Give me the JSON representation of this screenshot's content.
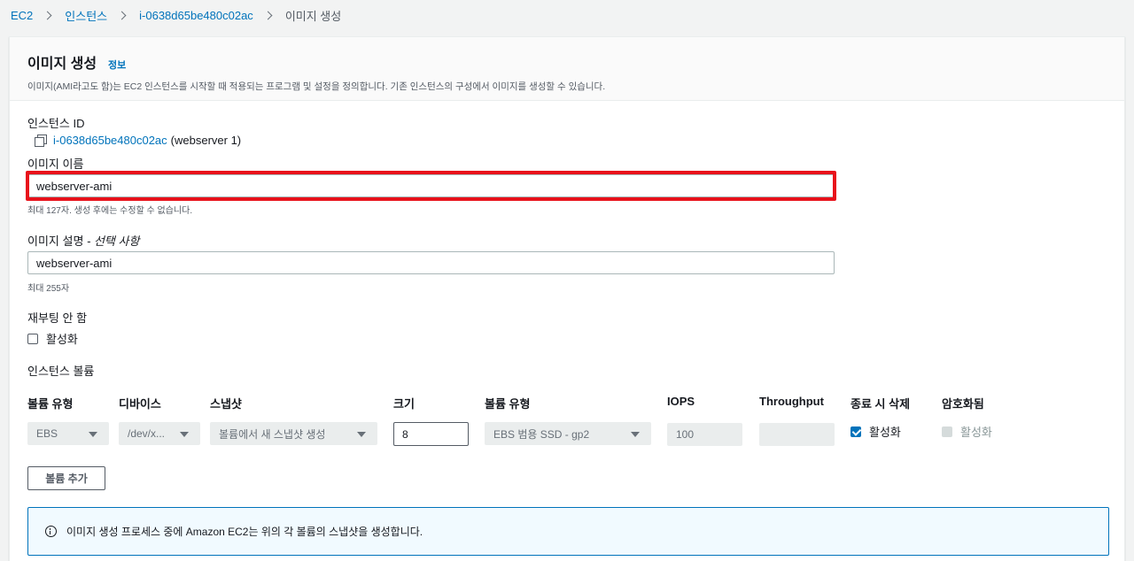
{
  "breadcrumb": {
    "items": [
      "EC2",
      "인스턴스",
      "i-0638d65be480c02ac"
    ],
    "current": "이미지 생성"
  },
  "header": {
    "title": "이미지 생성",
    "info_link": "정보",
    "description": "이미지(AMI라고도 함)는 EC2 인스턴스를 시작할 때 적용되는 프로그램 및 설정을 정의합니다. 기존 인스턴스의 구성에서 이미지를 생성할 수 있습니다."
  },
  "instance": {
    "label": "인스턴스 ID",
    "id": "i-0638d65be480c02ac",
    "name_suffix": "(webserver 1)"
  },
  "image_name": {
    "label": "이미지 이름",
    "value": "webserver-ami",
    "hint": "최대 127자. 생성 후에는 수정할 수 없습니다."
  },
  "image_description": {
    "label": "이미지 설명",
    "label_optional": " - 선택 사항",
    "value": "webserver-ami",
    "hint": "최대 255자"
  },
  "no_reboot": {
    "label": "재부팅 안 함",
    "checkbox_label": "활성화",
    "checked": false
  },
  "volumes": {
    "label": "인스턴스 볼륨",
    "columns": [
      "볼륨 유형",
      "디바이스",
      "스냅샷",
      "크기",
      "볼륨 유형",
      "IOPS",
      "Throughput",
      "종료 시 삭제",
      "암호화됨"
    ],
    "row": {
      "volume_type": "EBS",
      "device": "/dev/x...",
      "snapshot": "볼륨에서 새 스냅샷 생성",
      "size": "8",
      "ebs_type": "EBS 범용 SSD - gp2",
      "iops": "100",
      "throughput": "",
      "delete_on_termination_label": "활성화",
      "encrypted_label": "활성화"
    },
    "add_button": "볼륨 추가"
  },
  "alert": {
    "icon": "info-icon",
    "text": "이미지 생성 프로세스 중에 Amazon EC2는 위의 각 볼륨의 스냅샷을 생성합니다."
  },
  "colors": {
    "link": "#0073bb",
    "highlight": "#e8121b"
  }
}
